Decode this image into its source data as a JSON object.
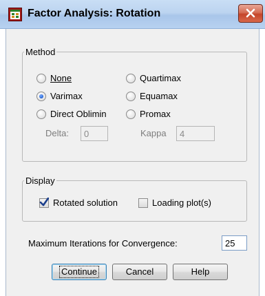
{
  "window": {
    "title": "Factor Analysis: Rotation",
    "icon": "spss-dialog-icon",
    "close_icon": "close-icon"
  },
  "method": {
    "legend": "Method",
    "options": [
      {
        "label": "None",
        "checked": false
      },
      {
        "label": "Quartimax",
        "checked": false
      },
      {
        "label": "Varimax",
        "checked": true
      },
      {
        "label": "Equamax",
        "checked": false
      },
      {
        "label": "Direct Oblimin",
        "checked": false
      },
      {
        "label": "Promax",
        "checked": false
      }
    ],
    "delta_label": "Delta:",
    "delta_value": "0",
    "kappa_label": "Kappa",
    "kappa_value": "4"
  },
  "display": {
    "legend": "Display",
    "rotated_solution_label": "Rotated solution",
    "rotated_solution_checked": true,
    "loading_plots_label": "Loading plot(s)",
    "loading_plots_checked": false
  },
  "iterations": {
    "label": "Maximum Iterations for Convergence:",
    "value": "25"
  },
  "buttons": {
    "continue": "Continue",
    "cancel": "Cancel",
    "help": "Help"
  },
  "colors": {
    "title_bar": "#bcd4f0",
    "close_button": "#c4452a",
    "dialog_background": "#f0f0f0",
    "radio_selected": "#1f5fd1",
    "checkmark": "#1c3f8c"
  }
}
